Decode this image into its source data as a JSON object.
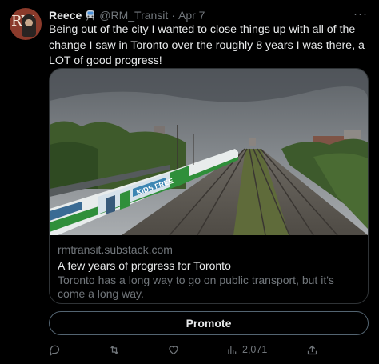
{
  "author": {
    "display_name": "Reece",
    "avatar_letters": "RM",
    "badge_icon": "train-emoji-icon",
    "handle": "@RM_Transit",
    "separator": "·",
    "date": "Apr 7"
  },
  "tweet": {
    "text": "Being out of the city I wanted to close things up with all of the change I saw in Toronto over the roughly 8 years I was there, a LOT of good progress!"
  },
  "card": {
    "image_icon": "commuter-train-photo",
    "train_livery_text": "KIDS FREE",
    "domain": "rmtransit.substack.com",
    "title": "A few years of progress for Toronto",
    "description": "Toronto has a long way to go on public transport, but it's come a long way."
  },
  "promote": {
    "label": "Promote"
  },
  "actions": {
    "reply_icon": "reply-icon",
    "retweet_icon": "retweet-icon",
    "like_icon": "heart-icon",
    "views_icon": "views-icon",
    "views_count": "2,071",
    "share_icon": "share-icon"
  },
  "colors": {
    "background": "#000000",
    "text": "#e7e9ea",
    "muted": "#71767b",
    "border": "#2f3336",
    "train_green": "#2f8f3a"
  }
}
